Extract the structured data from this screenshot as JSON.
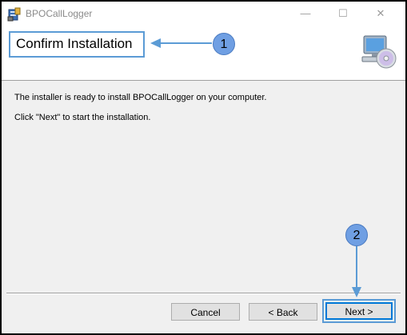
{
  "window": {
    "title": "BPOCallLogger",
    "minimize_glyph": "—",
    "maximize_glyph": "☐",
    "close_glyph": "✕"
  },
  "header": {
    "heading": "Confirm Installation",
    "icon": "computer-cd-icon"
  },
  "content": {
    "line1": "The installer is ready to install BPOCallLogger on your computer.",
    "line2": "Click \"Next\" to start the installation."
  },
  "buttons": {
    "cancel": "Cancel",
    "back": "< Back",
    "next": "Next >"
  },
  "annotations": {
    "badge1": "1",
    "badge2": "2",
    "color": "#5b9bd5"
  }
}
